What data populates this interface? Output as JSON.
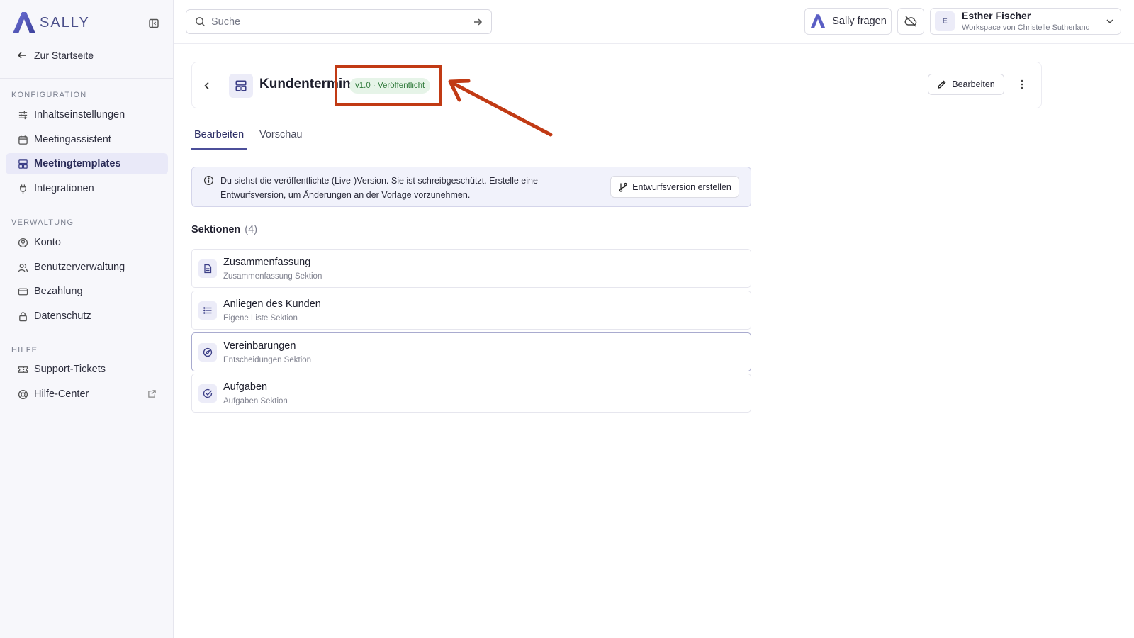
{
  "app": {
    "name": "SALLY"
  },
  "sidebar": {
    "home_label": "Zur Startseite",
    "groups": [
      {
        "label": "KONFIGURATION",
        "items": [
          {
            "label": "Inhaltseinstellungen",
            "icon": "sliders-icon"
          },
          {
            "label": "Meetingassistent",
            "icon": "calendar-icon"
          },
          {
            "label": "Meetingtemplates",
            "icon": "layout-template-icon",
            "active": true
          },
          {
            "label": "Integrationen",
            "icon": "plug-icon"
          }
        ]
      },
      {
        "label": "VERWALTUNG",
        "items": [
          {
            "label": "Konto",
            "icon": "user-circle-icon"
          },
          {
            "label": "Benutzerverwaltung",
            "icon": "users-icon"
          },
          {
            "label": "Bezahlung",
            "icon": "credit-card-icon"
          },
          {
            "label": "Datenschutz",
            "icon": "lock-icon"
          }
        ]
      },
      {
        "label": "HILFE",
        "items": [
          {
            "label": "Support-Tickets",
            "icon": "ticket-icon"
          },
          {
            "label": "Hilfe-Center",
            "icon": "lifebuoy-icon",
            "external": true
          }
        ]
      }
    ]
  },
  "topbar": {
    "search_placeholder": "Suche",
    "ask_label": "Sally fragen",
    "user": {
      "initial": "E",
      "name": "Esther Fischer",
      "workspace": "Workspace von Christelle Sutherland"
    }
  },
  "template": {
    "title": "Kundentermin",
    "version_badge": "v1.0 · Veröffentlicht",
    "edit_label": "Bearbeiten"
  },
  "tabs": [
    {
      "label": "Bearbeiten",
      "active": true
    },
    {
      "label": "Vorschau",
      "active": false
    }
  ],
  "notice": {
    "text": "Du siehst die veröffentlichte (Live-)Version. Sie ist schreibgeschützt. Erstelle eine Entwurfsversion, um Änderungen an der Vorlage vorzunehmen.",
    "button_label": "Entwurfsversion erstellen"
  },
  "sections": {
    "heading": "Sektionen",
    "count": "(4)",
    "items": [
      {
        "title": "Zusammenfassung",
        "subtitle": "Zusammenfassung Sektion",
        "icon": "document-icon"
      },
      {
        "title": "Anliegen des Kunden",
        "subtitle": "Eigene Liste Sektion",
        "icon": "list-icon"
      },
      {
        "title": "Vereinbarungen",
        "subtitle": "Entscheidungen Sektion",
        "icon": "compass-icon",
        "selected": true
      },
      {
        "title": "Aufgaben",
        "subtitle": "Aufgaben Sektion",
        "icon": "check-circle-icon"
      }
    ]
  },
  "colors": {
    "accent": "#4c4f9a",
    "annotation": "#c13a14",
    "badge_bg": "#e6f4e8",
    "badge_text": "#2f7a3a"
  }
}
